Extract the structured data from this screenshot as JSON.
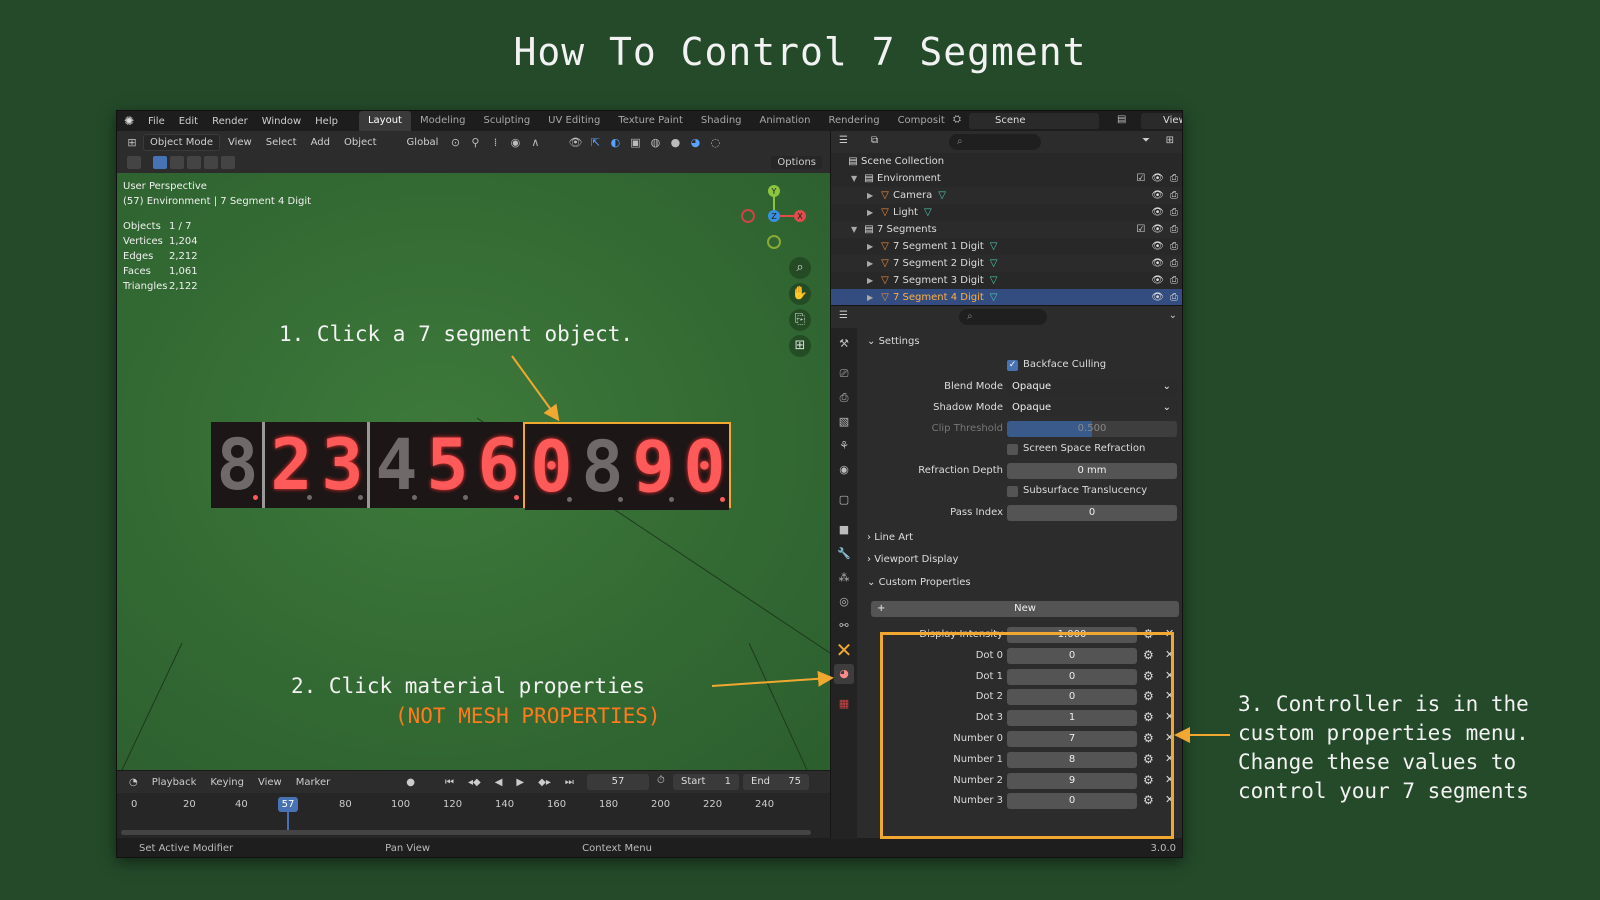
{
  "page_title": "How To Control 7 Segment",
  "annotations": {
    "step1": "1. Click a 7 segment object.",
    "step2": "2. Click material properties",
    "step2_note": "(NOT MESH PROPERTIES)",
    "step3": [
      "3. Controller is in the",
      "custom properties menu.",
      "Change these values to",
      "control your 7 segments"
    ]
  },
  "colors": {
    "accent_orange": "#f0a830",
    "selection_blue": "#4772b3",
    "segment_on": "#ff5a5a",
    "background": "#244a2a"
  },
  "topbar": {
    "menus": [
      "File",
      "Edit",
      "Render",
      "Window",
      "Help"
    ],
    "workspaces": [
      "Layout",
      "Modeling",
      "Sculpting",
      "UV Editing",
      "Texture Paint",
      "Shading",
      "Animation",
      "Rendering",
      "Composit"
    ],
    "active_workspace": "Layout",
    "scene": "Scene",
    "view_layer": "ViewLayer"
  },
  "viewport": {
    "mode": "Object Mode",
    "menus": [
      "View",
      "Select",
      "Add",
      "Object"
    ],
    "orientation": "Global",
    "options_label": "Options",
    "perspective": "User Perspective",
    "context": "(57) Environment | 7 Segment 4 Digit",
    "stats": [
      {
        "k": "Objects",
        "v": "1 / 7"
      },
      {
        "k": "Vertices",
        "v": "1,204"
      },
      {
        "k": "Edges",
        "v": "2,212"
      },
      {
        "k": "Faces",
        "v": "1,061"
      },
      {
        "k": "Triangles",
        "v": "2,122"
      }
    ],
    "gizmo_axes": [
      "Y",
      "Z",
      "X"
    ],
    "nav_icons": [
      "zoom-icon",
      "pan-hand-icon",
      "camera-icon",
      "grid-icon"
    ]
  },
  "display_digits": [
    {
      "ch": "8",
      "on": false,
      "dot_on": true
    },
    {
      "ch": "2",
      "on": true,
      "dot_on": false
    },
    {
      "ch": "3",
      "on": true,
      "dot_on": false
    },
    {
      "ch": "4",
      "on": false,
      "dot_on": false
    },
    {
      "ch": "5",
      "on": true,
      "dot_on": false
    },
    {
      "ch": "6",
      "on": true,
      "dot_on": true
    },
    {
      "ch": "0",
      "on": true,
      "dot_on": false
    },
    {
      "ch": "8",
      "on": false,
      "dot_on": false
    },
    {
      "ch": "9",
      "on": true,
      "dot_on": false
    },
    {
      "ch": "0",
      "on": true,
      "dot_on": true
    }
  ],
  "timeline": {
    "menus": [
      "Playback",
      "Keying",
      "View",
      "Marker"
    ],
    "current_frame": "57",
    "start_label": "Start",
    "start": "1",
    "end_label": "End",
    "end": "75",
    "ticks": [
      "0",
      "20",
      "40",
      "57",
      "80",
      "100",
      "120",
      "140",
      "160",
      "180",
      "200",
      "220",
      "240"
    ]
  },
  "statusbar": {
    "items": [
      "Set Active Modifier",
      "Pan View",
      "Context Menu"
    ],
    "version": "3.0.0"
  },
  "outliner": {
    "root": "Scene Collection",
    "rows": [
      {
        "label": "Environment",
        "type": "collection",
        "indent": 1
      },
      {
        "label": "Camera",
        "type": "object",
        "indent": 2
      },
      {
        "label": "Light",
        "type": "object",
        "indent": 2
      },
      {
        "label": "7 Segments",
        "type": "collection",
        "indent": 1
      },
      {
        "label": "7 Segment 1 Digit",
        "type": "object",
        "indent": 2
      },
      {
        "label": "7 Segment 2 Digit",
        "type": "object",
        "indent": 2
      },
      {
        "label": "7 Segment 3 Digit",
        "type": "object",
        "indent": 2
      },
      {
        "label": "7 Segment 4 Digit",
        "type": "object",
        "indent": 2,
        "selected": true
      }
    ]
  },
  "properties": {
    "settings_title": "Settings",
    "backface_culling": "Backface Culling",
    "blend_mode_label": "Blend Mode",
    "blend_mode": "Opaque",
    "shadow_mode_label": "Shadow Mode",
    "shadow_mode": "Opaque",
    "clip_threshold_label": "Clip Threshold",
    "clip_threshold": "0.500",
    "screen_space_refraction": "Screen Space Refraction",
    "refraction_depth_label": "Refraction Depth",
    "refraction_depth": "0 mm",
    "subsurface_translucency": "Subsurface Translucency",
    "pass_index_label": "Pass Index",
    "pass_index": "0",
    "line_art": "Line Art",
    "viewport_display": "Viewport Display",
    "custom_properties": "Custom Properties",
    "new_label": "New",
    "custom": [
      {
        "label": "Display Intensity",
        "value": "1.000"
      },
      {
        "label": "Dot 0",
        "value": "0"
      },
      {
        "label": "Dot 1",
        "value": "0"
      },
      {
        "label": "Dot 2",
        "value": "0"
      },
      {
        "label": "Dot 3",
        "value": "1"
      },
      {
        "label": "Number 0",
        "value": "7"
      },
      {
        "label": "Number 1",
        "value": "8"
      },
      {
        "label": "Number 2",
        "value": "9"
      },
      {
        "label": "Number 3",
        "value": "0"
      }
    ]
  }
}
